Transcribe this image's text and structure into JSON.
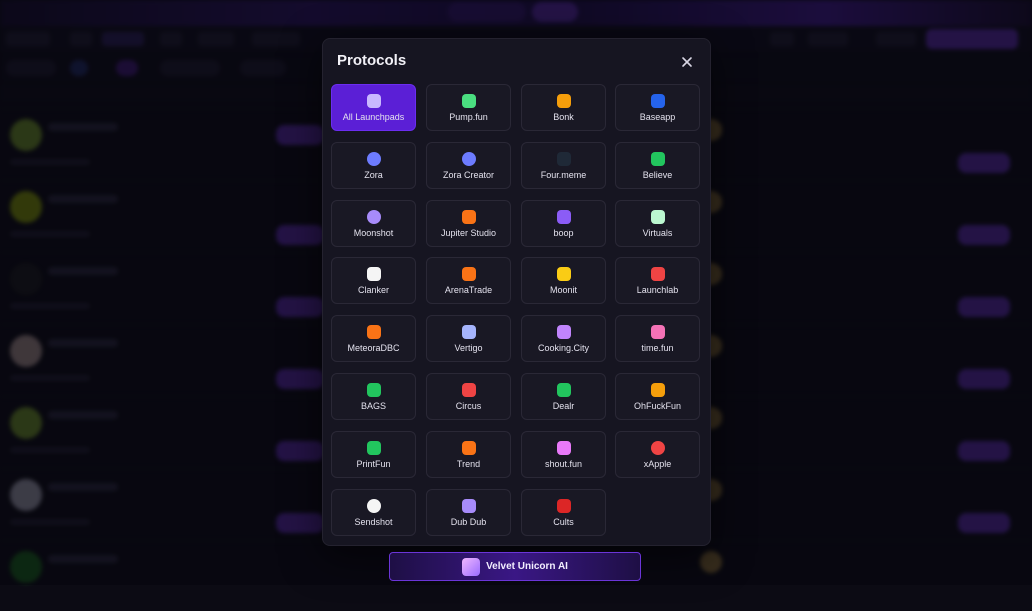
{
  "modal": {
    "title": "Protocols",
    "close_icon": "close-icon"
  },
  "protocols": [
    {
      "label": "All Launchpads",
      "icon": "grid-scan-icon",
      "color": "#c9b8ff",
      "active": true
    },
    {
      "label": "Pump.fun",
      "icon": "pill-icon",
      "color": "#4ade80"
    },
    {
      "label": "Bonk",
      "icon": "bonk-icon",
      "color": "#f59e0b"
    },
    {
      "label": "Baseapp",
      "icon": "square-icon",
      "color": "#2563eb"
    },
    {
      "label": "Zora",
      "icon": "orb-icon",
      "color": "#6d7cff"
    },
    {
      "label": "Zora Creator",
      "icon": "orb-icon",
      "color": "#6d7cff"
    },
    {
      "label": "Four.meme",
      "icon": "four-meme-icon",
      "color": "#1f2937"
    },
    {
      "label": "Believe",
      "icon": "believe-icon",
      "color": "#22c55e"
    },
    {
      "label": "Moonshot",
      "icon": "moon-icon",
      "color": "#a78bfa"
    },
    {
      "label": "Jupiter Studio",
      "icon": "jupiter-icon",
      "color": "#f97316"
    },
    {
      "label": "boop",
      "icon": "boop-icon",
      "color": "#8b5cf6"
    },
    {
      "label": "Virtuals",
      "icon": "virtuals-icon",
      "color": "#bbf7d0"
    },
    {
      "label": "Clanker",
      "icon": "clanker-icon",
      "color": "#f5f5f5"
    },
    {
      "label": "ArenaTrade",
      "icon": "arena-icon",
      "color": "#f97316"
    },
    {
      "label": "Moonit",
      "icon": "arrow-icon",
      "color": "#facc15"
    },
    {
      "label": "Launchlab",
      "icon": "launchlab-icon",
      "color": "#ef4444"
    },
    {
      "label": "MeteoraDBC",
      "icon": "meteora-icon",
      "color": "#f97316"
    },
    {
      "label": "Vertigo",
      "icon": "vertigo-icon",
      "color": "#a5b4fc"
    },
    {
      "label": "Cooking.City",
      "icon": "cooking-icon",
      "color": "#c084fc"
    },
    {
      "label": "time.fun",
      "icon": "hourglass-icon",
      "color": "#f472b6"
    },
    {
      "label": "BAGS",
      "icon": "bag-icon",
      "color": "#22c55e"
    },
    {
      "label": "Circus",
      "icon": "circus-icon",
      "color": "#ef4444"
    },
    {
      "label": "Dealr",
      "icon": "dealr-icon",
      "color": "#22c55e"
    },
    {
      "label": "OhFuckFun",
      "icon": "ohfuck-icon",
      "color": "#f59e0b"
    },
    {
      "label": "PrintFun",
      "icon": "printfun-icon",
      "color": "#22c55e"
    },
    {
      "label": "Trend",
      "icon": "flame-icon",
      "color": "#f97316"
    },
    {
      "label": "shout.fun",
      "icon": "shout-icon",
      "color": "#e879f9"
    },
    {
      "label": "xApple",
      "icon": "apple-icon",
      "color": "#ef4444"
    },
    {
      "label": "Sendshot",
      "icon": "sendshot-icon",
      "color": "#f5f5f5"
    },
    {
      "label": "Dub Dub",
      "icon": "dubdub-icon",
      "color": "#a78bfa"
    },
    {
      "label": "Cults",
      "icon": "cults-icon",
      "color": "#dc2626"
    }
  ],
  "banner": {
    "label": "Velvet Unicorn AI",
    "icon": "unicorn-avatar-icon"
  },
  "colors": {
    "accent": "#7c3aed",
    "active_tile": "#5b1fd6",
    "modal_bg": "#161521"
  }
}
